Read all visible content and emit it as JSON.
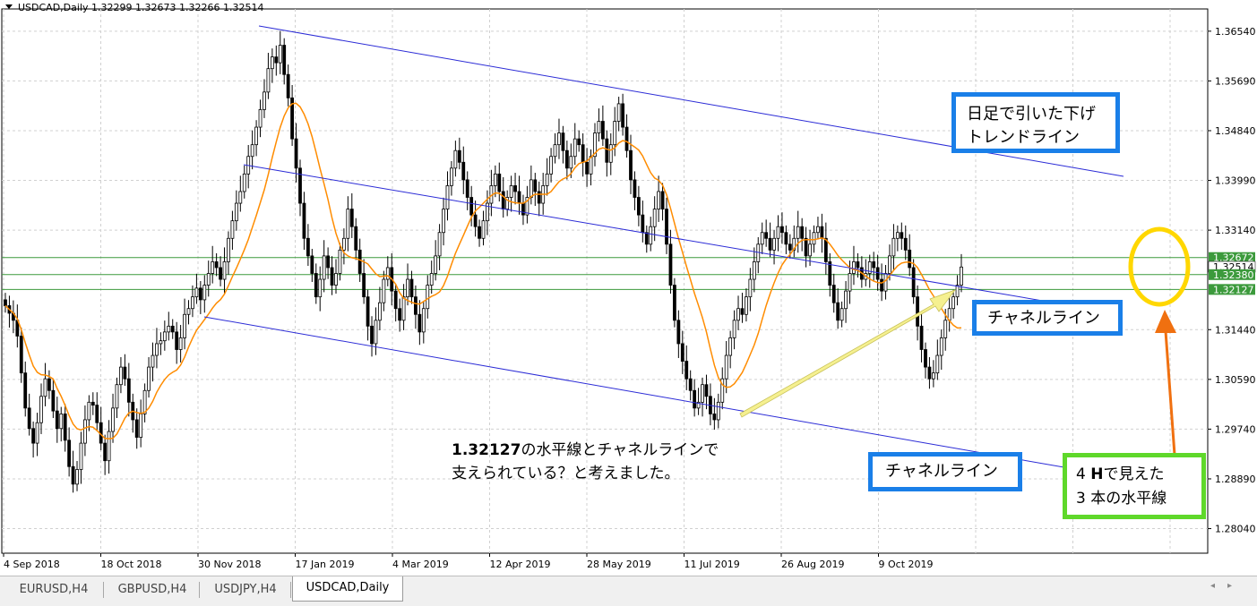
{
  "header": {
    "title": "USDCAD,Daily",
    "ohlc": "1.32299 1.32673 1.32266 1.32514"
  },
  "colors": {
    "channel_line": "#2b2bd6",
    "moving_average": "#ff8c00",
    "horizontal_lines": "#3c9a3c",
    "callout_blue": "#1a7fe8",
    "callout_green": "#5fd82a",
    "circle": "#ffd700",
    "arrow_orange": "#f07010",
    "arrow_yellow": "#f5f090"
  },
  "chart_data": {
    "type": "candlestick",
    "symbol": "USDCAD",
    "timeframe": "Daily",
    "ylim": [
      1.2762,
      1.3692
    ],
    "y_ticks": [
      "1.36540",
      "1.35690",
      "1.34840",
      "1.33990",
      "1.33140",
      "1.30590",
      "1.29740",
      "1.28890",
      "1.28040",
      "1.31440"
    ],
    "x_ticks": [
      "4 Sep 2018",
      "18 Oct 2018",
      "30 Nov 2018",
      "17 Jan 2019",
      "4 Mar 2019",
      "12 Apr 2019",
      "28 May 2019",
      "11 Jul 2019",
      "26 Aug 2019",
      "9 Oct 2019"
    ],
    "price_labels": [
      {
        "text": "1.32672",
        "value": 1.32672,
        "highlight": true
      },
      {
        "text": "1.32514",
        "value": 1.32514,
        "highlight": false
      },
      {
        "text": "1.32380",
        "value": 1.3238,
        "highlight": true
      },
      {
        "text": "1.32127",
        "value": 1.32127,
        "highlight": true
      }
    ],
    "horizontal_lines": [
      1.32672,
      1.3238,
      1.32127
    ],
    "closes": [
      1.3185,
      1.3172,
      1.316,
      1.3133,
      1.307,
      1.301,
      1.2975,
      1.295,
      1.2985,
      1.303,
      1.306,
      1.304,
      1.3005,
      1.2975,
      1.3,
      1.2955,
      1.291,
      1.288,
      1.2905,
      1.295,
      1.299,
      1.302,
      1.3015,
      1.2985,
      1.295,
      1.292,
      1.297,
      1.301,
      1.305,
      1.308,
      1.306,
      1.302,
      1.299,
      1.296,
      1.3,
      1.304,
      1.308,
      1.31,
      1.312,
      1.3125,
      1.314,
      1.315,
      1.314,
      1.311,
      1.313,
      1.317,
      1.318,
      1.32,
      1.3215,
      1.3195,
      1.322,
      1.324,
      1.326,
      1.325,
      1.323,
      1.326,
      1.33,
      1.333,
      1.336,
      1.338,
      1.341,
      1.344,
      1.346,
      1.349,
      1.352,
      1.355,
      1.359,
      1.361,
      1.36,
      1.363,
      1.358,
      1.354,
      1.347,
      1.342,
      1.336,
      1.33,
      1.327,
      1.324,
      1.32,
      1.323,
      1.327,
      1.325,
      1.322,
      1.324,
      1.328,
      1.33,
      1.335,
      1.332,
      1.328,
      1.324,
      1.32,
      1.315,
      1.312,
      1.316,
      1.319,
      1.323,
      1.325,
      1.321,
      1.318,
      1.316,
      1.32,
      1.323,
      1.32,
      1.317,
      1.314,
      1.318,
      1.322,
      1.324,
      1.327,
      1.331,
      1.335,
      1.339,
      1.342,
      1.345,
      1.343,
      1.34,
      1.337,
      1.334,
      1.332,
      1.33,
      1.333,
      1.336,
      1.339,
      1.341,
      1.338,
      1.335,
      1.337,
      1.339,
      1.338,
      1.336,
      1.334,
      1.337,
      1.34,
      1.338,
      1.336,
      1.339,
      1.341,
      1.344,
      1.346,
      1.348,
      1.345,
      1.342,
      1.344,
      1.347,
      1.346,
      1.343,
      1.341,
      1.344,
      1.348,
      1.35,
      1.347,
      1.343,
      1.346,
      1.35,
      1.353,
      1.349,
      1.345,
      1.34,
      1.337,
      1.334,
      1.331,
      1.329,
      1.332,
      1.335,
      1.338,
      1.335,
      1.329,
      1.322,
      1.316,
      1.312,
      1.309,
      1.306,
      1.304,
      1.301,
      1.302,
      1.305,
      1.303,
      1.3,
      1.299,
      1.302,
      1.306,
      1.31,
      1.313,
      1.316,
      1.318,
      1.317,
      1.32,
      1.323,
      1.326,
      1.329,
      1.331,
      1.33,
      1.328,
      1.33,
      1.332,
      1.331,
      1.329,
      1.328,
      1.33,
      1.332,
      1.33,
      1.327,
      1.329,
      1.331,
      1.332,
      1.33,
      1.326,
      1.322,
      1.319,
      1.316,
      1.318,
      1.321,
      1.324,
      1.326,
      1.325,
      1.323,
      1.324,
      1.326,
      1.325,
      1.323,
      1.321,
      1.324,
      1.327,
      1.33,
      1.331,
      1.33,
      1.328,
      1.325,
      1.32,
      1.315,
      1.311,
      1.308,
      1.306,
      1.307,
      1.31,
      1.313,
      1.316,
      1.318,
      1.32,
      1.322,
      1.3251
    ]
  },
  "annotations": {
    "trend_label": [
      "日足で引いた下げ",
      "トレンドライン"
    ],
    "channel_label_1": "チャネルライン",
    "channel_label_2": "チャネルライン",
    "support_note_strong": "1.32127",
    "support_note_rest": "の水平線とチャネルラインで",
    "support_note_line2": "支えられている？と考えました。",
    "h4_line1_a": "4 ",
    "h4_line1_b": "H",
    "h4_line1_c": "で見えた",
    "h4_line2": "3 本の水平線"
  },
  "tabs": [
    {
      "label": "EURUSD,H4",
      "active": false
    },
    {
      "label": "GBPUSD,H4",
      "active": false
    },
    {
      "label": "USDJPY,H4",
      "active": false
    },
    {
      "label": "USDCAD,Daily",
      "active": true
    }
  ],
  "icons": {
    "header_menu": "triangle-down-icon",
    "scroll_left": "chevron-left-icon",
    "scroll_right": "chevron-right-icon"
  }
}
